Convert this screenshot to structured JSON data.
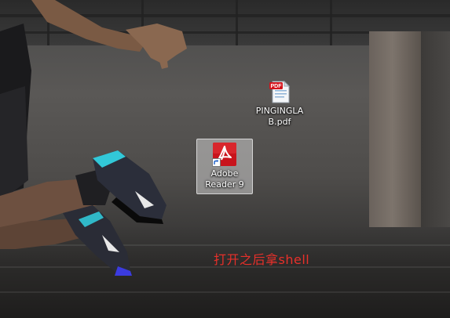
{
  "desktop": {
    "icons": [
      {
        "id": "pdf-file",
        "label_line1": "PINGINGLA",
        "label_line2": "B.pdf",
        "icon": "pdf-document-icon",
        "selected": false
      },
      {
        "id": "adobe-reader",
        "label_line1": "Adobe",
        "label_line2": "Reader 9",
        "icon": "adobe-reader-icon",
        "shortcut": true,
        "selected": true
      }
    ],
    "annotation": "打开之后拿shell"
  },
  "colors": {
    "annotation": "#e8302a",
    "adobe_red": "#c8141c",
    "selection": "#cdcdcd"
  }
}
